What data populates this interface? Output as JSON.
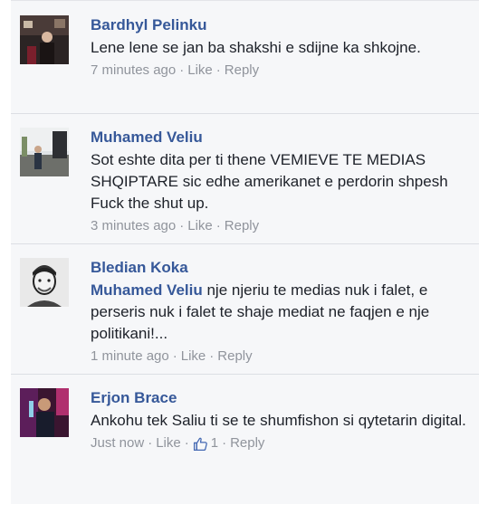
{
  "comments": [
    {
      "author": "Bardhyl Pelinku",
      "text": "Lene lene se jan ba shakshi e sdijne ka shkojne.",
      "time": "7 minutes ago",
      "like_label": "Like",
      "reply_label": "Reply",
      "separator": "·"
    },
    {
      "author": "Muhamed Veliu",
      "text": "Sot eshte dita per ti thene VEMIEVE TE MEDIAS SHQIPTARE sic edhe amerikanet e perdorin shpesh Fuck the shut up.",
      "time": "3 minutes ago",
      "like_label": "Like",
      "reply_label": "Reply",
      "separator": "·"
    },
    {
      "author": "Bledian Koka",
      "mention": "Muhamed Veliu",
      "text": " nje njeriu te medias nuk i falet, e perseris nuk i falet te shaje mediat ne faqjen e nje politikani!...",
      "time": "1 minute ago",
      "like_label": "Like",
      "reply_label": "Reply",
      "separator": "·"
    },
    {
      "author": "Erjon Brace",
      "text": "Ankohu tek Saliu ti se te shumfishon si qytetarin digital.",
      "time": "Just now",
      "like_label": "Like",
      "like_count": "1",
      "reply_label": "Reply",
      "separator": "·",
      "like_icon": "thumbs-up-icon"
    }
  ],
  "colors": {
    "author": "#365899",
    "text": "#1d2129",
    "meta": "#90949c",
    "background": "#f6f7f9",
    "divider": "#dcdfe4"
  }
}
